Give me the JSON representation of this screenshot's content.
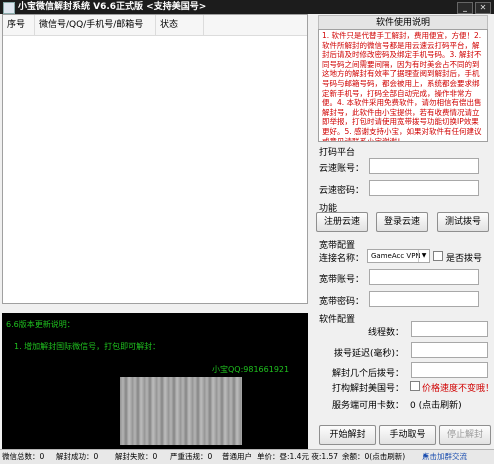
{
  "window": {
    "title": "小宝微信解封系统 V6.6正式版 <支持美国号>",
    "minimize_glyph": "_",
    "close_glyph": "✕"
  },
  "list": {
    "columns": [
      "序号",
      "微信号/QQ/手机号/邮箱号",
      "状态"
    ],
    "rows": []
  },
  "log": {
    "line1": "6.6版本更新说明：",
    "line2": "1. 增加解封国际微信号，打包即可解封：",
    "qq": "小宝QQ:981661921"
  },
  "notice": {
    "header": "软件使用说明",
    "text": "1. 软件只是代替手工解封，费用便宜，方便！2. 软件所解封的微信号都是用云速云打码平台，解封后请及时修改密码及绑定手机号码。3. 解封不同号码之间需要间隔，因为有时美会占不同的到这地方的解封有效率了据理查阅到解封后，手机号码与邮箱号码，都会被用上，系统都会要求绑定新手机号，打码全部自动完成，操作非常方便。4. 本软件采用免费软件，请勿相信有偿出售解封号，此软件由小宝提供，若有收费情况请立即举报，打包时请使用宽带拨号功能切换IP效果更好。5. 感谢支持小宝，如果对软件有任何建议或意见请联系小宝谢谢！"
  },
  "dama": {
    "section": "打码平台",
    "account_label": "云速账号：",
    "password_label": "云速密码：",
    "account_value": "",
    "password_value": ""
  },
  "functions": {
    "section": "功能",
    "register_label": "注册云速",
    "login_label": "登录云速",
    "test_dial_label": "测试拨号"
  },
  "broadband": {
    "section": "宽带配置",
    "connection_label": "连接名称：",
    "connection_value": "GameAcc VPN",
    "dial_label": "是否拨号",
    "account_label": "宽带账号：",
    "password_label": "宽带密码：",
    "account_value": "",
    "password_value": ""
  },
  "software": {
    "section": "软件配置",
    "threads_label": "线程数：",
    "dial_delay_label": "拨号延迟(毫秒)：",
    "unlock_count_label": "解封几个后拨号：",
    "us_label": "打构解封美国号：",
    "us_warning": "价格速度不变哦！",
    "cards_label": "服务端可用卡数：",
    "cards_value": "0 (点击刷新)",
    "threads_value": "",
    "dial_delay_value": "",
    "unlock_count_value": ""
  },
  "actions": {
    "start_label": "开始解封",
    "manual_label": "手动取号",
    "stop_label": "停止解封"
  },
  "status": {
    "total": "微信总数：0",
    "success": "解封成功：0",
    "fail": "解封失败：0",
    "severe": "严重违规：0",
    "user_type": "普通用户",
    "price": "单价：昼:1.4元 夜:1.57",
    "balance": "余额：0(点击刷新)",
    "join": "点击加群交流"
  }
}
